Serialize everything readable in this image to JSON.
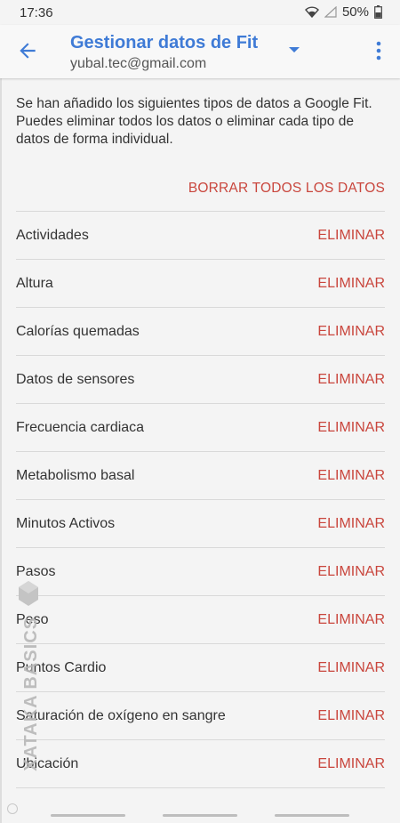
{
  "status_bar": {
    "time": "17:36",
    "battery": "50%"
  },
  "app_bar": {
    "title": "Gestionar datos de Fit",
    "account": "yubal.tec@gmail.com"
  },
  "intro": "Se han añadido los siguientes tipos de datos a Google Fit. Puedes eliminar todos los datos o eliminar cada tipo de datos de forma individual.",
  "delete_all_label": "BORRAR TODOS LOS DATOS",
  "data_types": [
    {
      "label": "Actividades",
      "action": "ELIMINAR"
    },
    {
      "label": "Altura",
      "action": "ELIMINAR"
    },
    {
      "label": "Calorías quemadas",
      "action": "ELIMINAR"
    },
    {
      "label": "Datos de sensores",
      "action": "ELIMINAR"
    },
    {
      "label": "Frecuencia cardiaca",
      "action": "ELIMINAR"
    },
    {
      "label": "Metabolismo basal",
      "action": "ELIMINAR"
    },
    {
      "label": "Minutos Activos",
      "action": "ELIMINAR"
    },
    {
      "label": "Pasos",
      "action": "ELIMINAR"
    },
    {
      "label": "Peso",
      "action": "ELIMINAR"
    },
    {
      "label": "Puntos Cardio",
      "action": "ELIMINAR"
    },
    {
      "label": "Saturación de oxígeno en sangre",
      "action": "ELIMINAR"
    },
    {
      "label": "Ubicación",
      "action": "ELIMINAR"
    }
  ],
  "watermark": "XATAKA BASICS",
  "icons": {
    "back": "arrow-back-icon",
    "dropdown": "triangle-down-icon",
    "overflow": "more-vert-icon",
    "wifi": "wifi-icon",
    "signal": "signal-icon",
    "battery": "battery-icon"
  },
  "colors": {
    "accent": "#3f7bd6",
    "destructive": "#c9463d"
  }
}
